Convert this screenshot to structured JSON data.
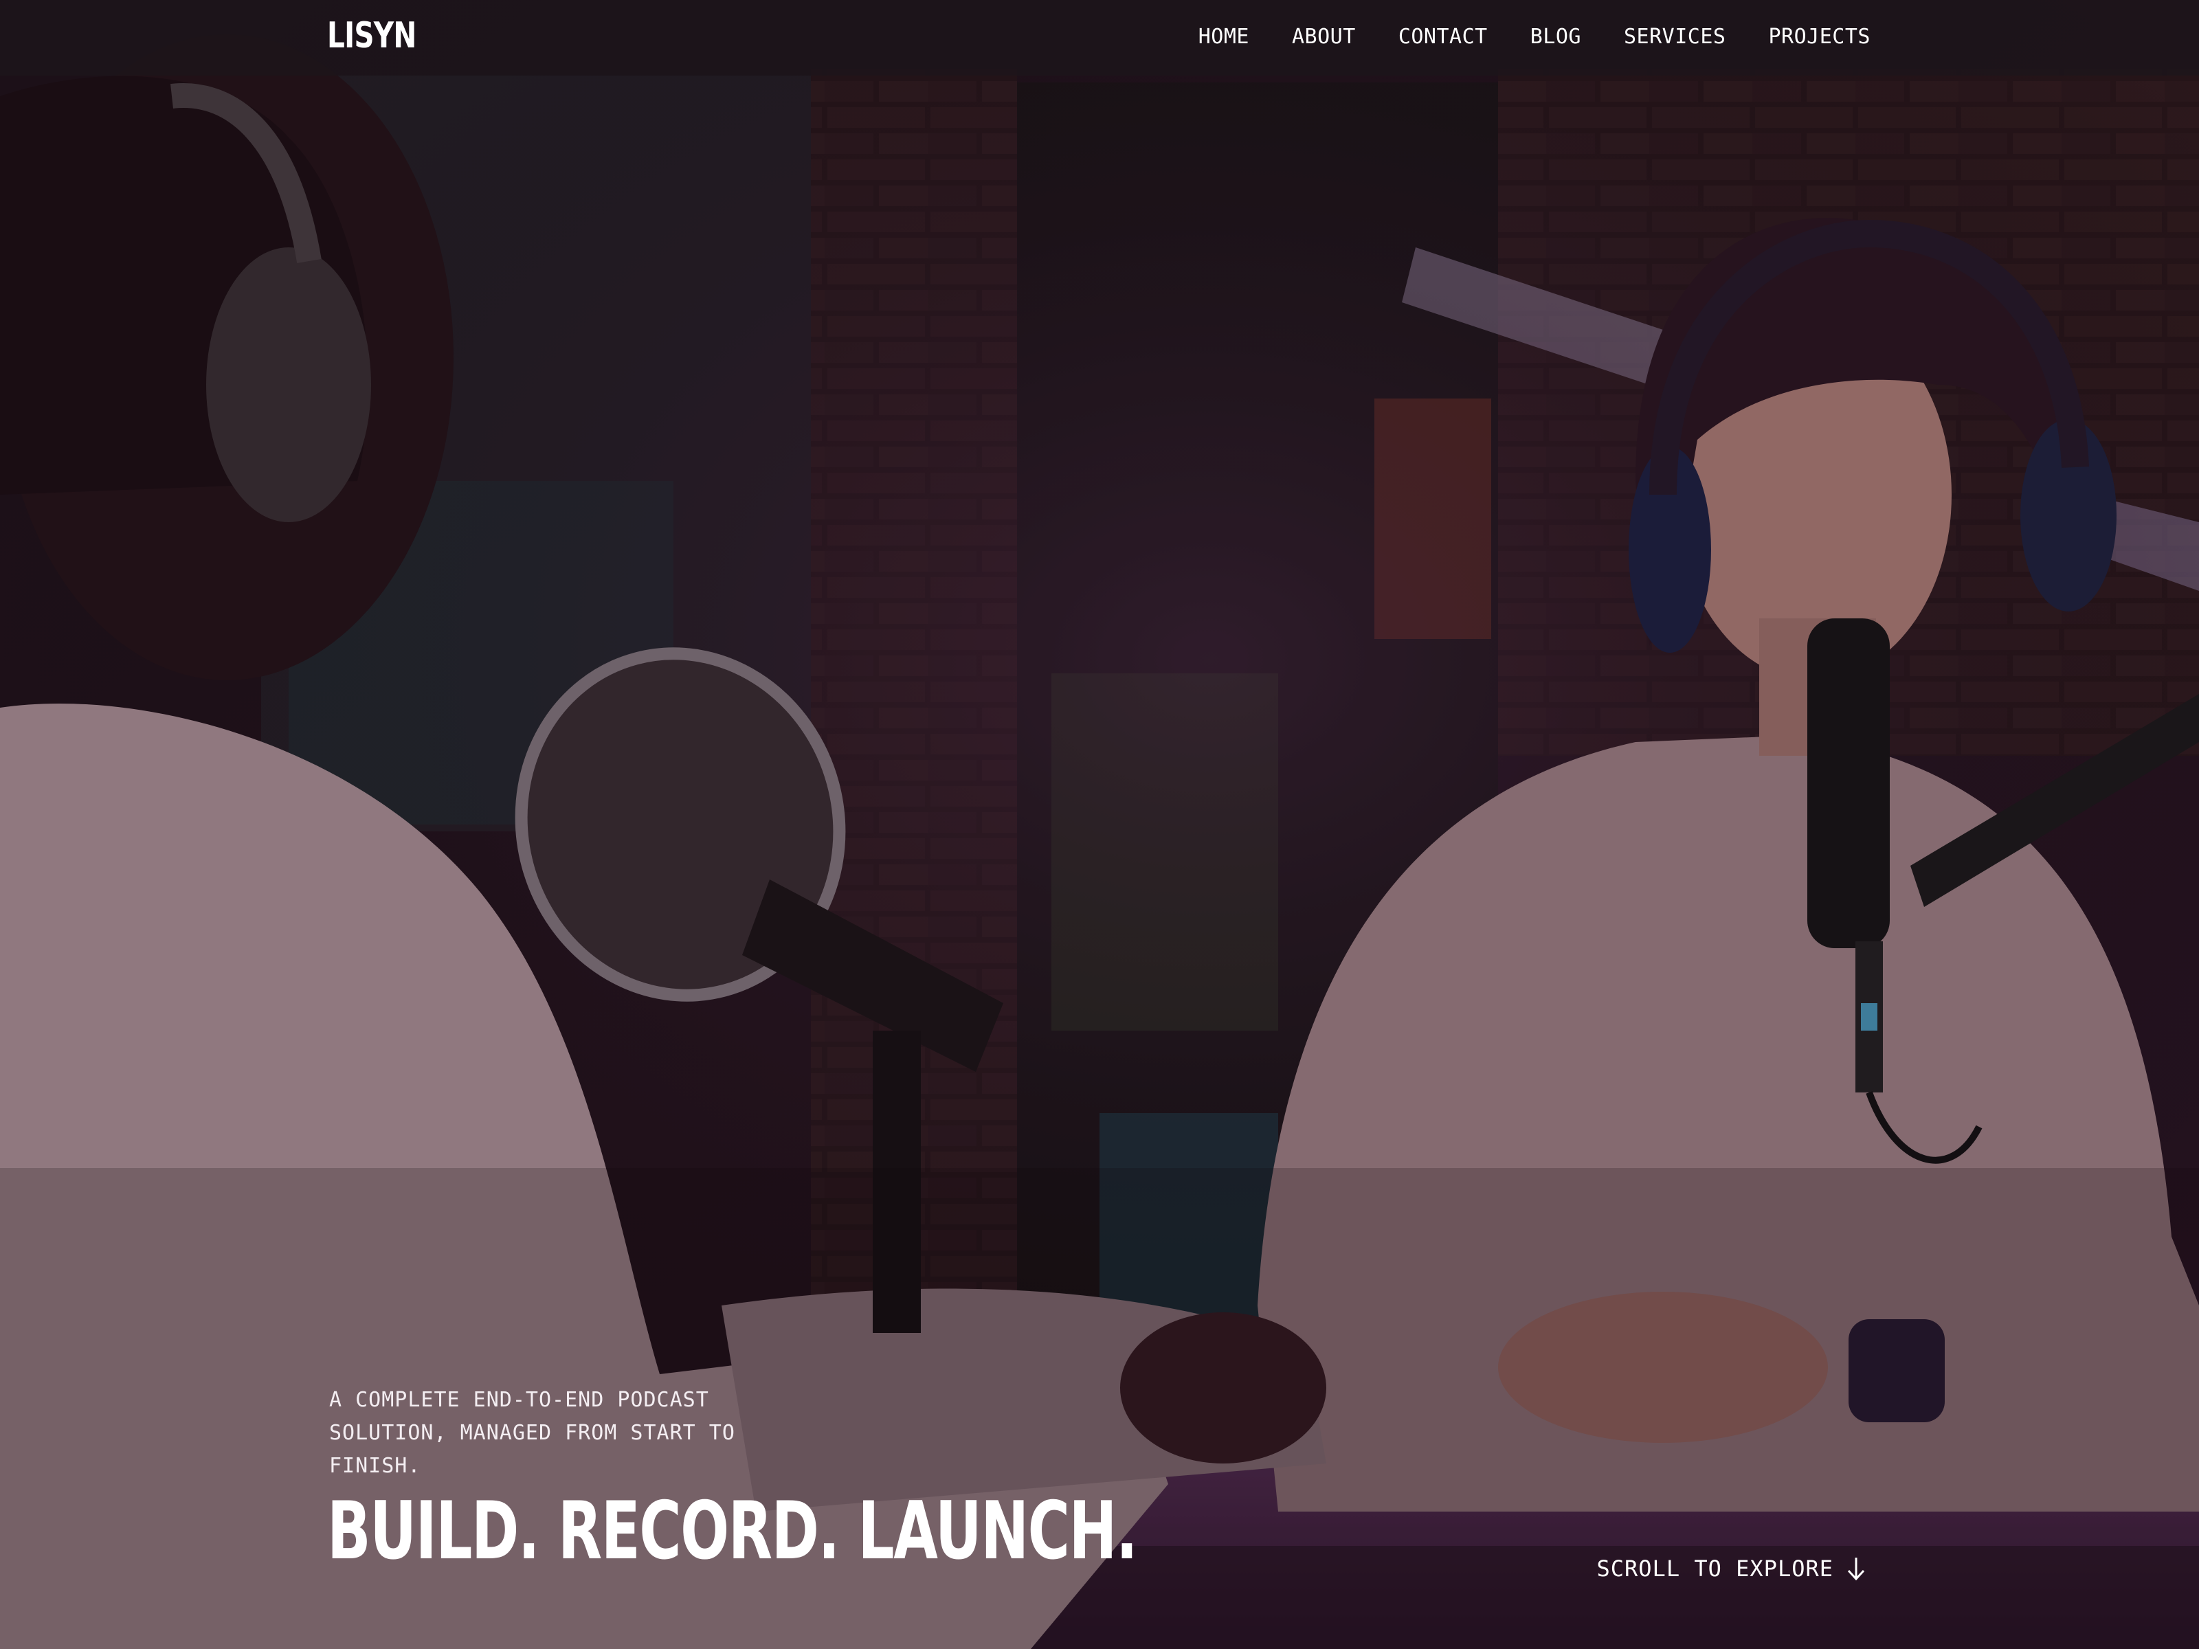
{
  "brand": {
    "logo": "LISYN"
  },
  "nav": {
    "items": [
      {
        "label": "HOME"
      },
      {
        "label": "ABOUT"
      },
      {
        "label": "CONTACT"
      },
      {
        "label": "BLOG"
      },
      {
        "label": "SERVICES"
      },
      {
        "label": "PROJECTS"
      }
    ]
  },
  "hero": {
    "tagline": "A COMPLETE END-TO-END PODCAST SOLUTION, MANAGED FROM START TO FINISH.",
    "headline": "BUILD. RECORD. LAUNCH.",
    "scroll_label": "SCROLL TO EXPLORE",
    "scroll_icon": "arrow-down-icon",
    "image_subject": "two people recording a podcast with microphones in a brick-walled studio"
  },
  "colors": {
    "text": "#ffffff",
    "nav_background": "#1c141a",
    "overlay": "#1a0d16",
    "accent_purple": "#7a3f78"
  }
}
